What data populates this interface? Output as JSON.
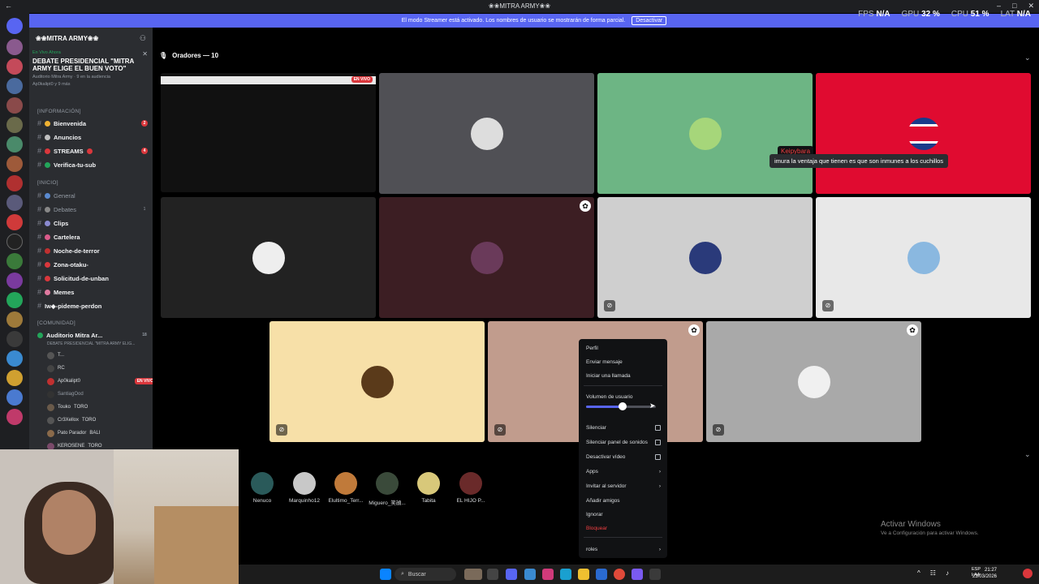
{
  "window": {
    "title": "❀❀MITRA ARMY❀❀"
  },
  "perf": {
    "fps_label": "FPS",
    "fps_value": "N/A",
    "gpu_label": "GPU",
    "gpu_value": "32 %",
    "cpu_label": "CPU",
    "cpu_value": "51 %",
    "lat_label": "LAT",
    "lat_value": "N/A"
  },
  "banner": {
    "text": "El modo Streamer está activado. Los nombres de usuario se mostrarán de forma parcial.",
    "button": "Desactivar"
  },
  "server": {
    "name": "❀❀MITRA ARMY❀❀"
  },
  "event": {
    "status": "En Vivo Ahora",
    "title": "DEBATE PRESIDENCIAL \"MITRA ARMY ELIGE EL BUEN VOTO\"",
    "sub": "Auditorio Mitra Army · 9 en la audiencia",
    "sub2": "Ap0kalipt0 y 9 más"
  },
  "categories": {
    "info": "[INFORMACIÓN]",
    "inicio": "[INICIO]",
    "comunidad": "[COMUNIDAD]"
  },
  "channels": {
    "bienvenida": "Bienvenida",
    "bienvenida_count": "2",
    "anuncios": "Anuncios",
    "streams": "STREAMS",
    "streams_count": "4",
    "verifica": "Verifica-tu-sub",
    "general": "General",
    "debates": "Debates",
    "debates_count": "1",
    "clips": "Clips",
    "cartelera": "Cartelera",
    "noche": "Noche-de-terror",
    "zona": "Zona-otaku-",
    "solicitud": "Solicitud-de-unban",
    "memes": "Memes",
    "pideme": "Iw◆-pideme-perdon",
    "auditorio": "Auditorio Mitra Ar...",
    "auditorio_count": "18",
    "auditorio_sub": "DEBATE PRESIDENCIAL \"MITRA ARMY ELIG..."
  },
  "voice_users": {
    "u1": "T...",
    "u2": "RC",
    "u3": "Ap0kalipt0",
    "u3_badge": "EN VIVO",
    "u4": "SantiagOod",
    "u5": "Touko",
    "u5_tag": "TORO",
    "u6": "Cr3Xellox",
    "u6_tag": "TORO",
    "u7": "Pato Parador",
    "u7_tag": "BALI",
    "u8": "KEROSENE",
    "u8_tag": "TORO"
  },
  "stage": {
    "title": "Oradores — 10",
    "live_badge": "EN VIVO"
  },
  "chat_popup": {
    "name": "Keipybara",
    "message": "imura la ventaja que tienen es que son inmunes a los cuchillos"
  },
  "audience": [
    "Nenuco",
    "Marquinho12",
    "Elultimo_Terr...",
    "Miguero_笑顔...",
    "Tabita",
    "EL HIJO P..."
  ],
  "context_menu": {
    "perfil": "Perfil",
    "enviar": "Enviar mensaje",
    "llamada": "Iniciar una llamada",
    "volumen": "Volumen de usuario",
    "volume_level": 0.52,
    "silenciar": "Silenciar",
    "silenciar_panel": "Silenciar panel de sonidos",
    "desactivar_video": "Desactivar vídeo",
    "apps": "Apps",
    "invitar": "Invitar al servidor",
    "anadir": "Añadir amigos",
    "ignorar": "Ignorar",
    "bloquear": "Bloquear",
    "roles": "roles"
  },
  "activate_windows": {
    "title": "Activar Windows",
    "sub": "Ve a Configuración para activar Windows."
  },
  "taskbar": {
    "search": "Buscar",
    "lang1": "ESP",
    "lang2": "LAA",
    "time": "21:27",
    "date": "23/03/2026"
  }
}
